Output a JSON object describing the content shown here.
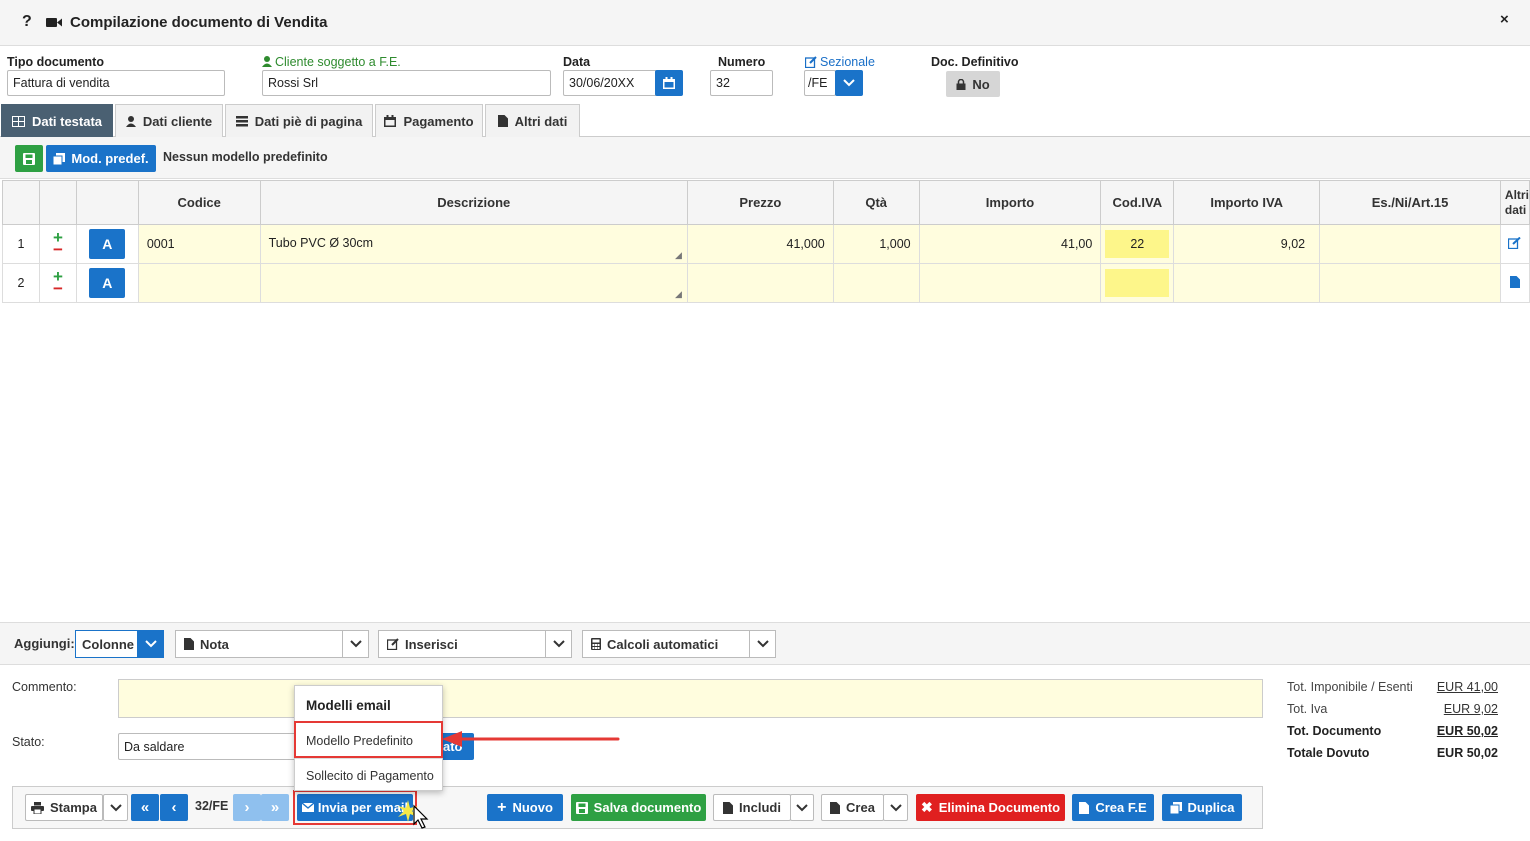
{
  "window": {
    "help": "?",
    "title": "Compilazione documento di Vendita",
    "close": "×"
  },
  "header": {
    "tipo_label": "Tipo documento",
    "tipo_value": "Fattura di vendita",
    "cliente_label": "Cliente soggetto a F.E.",
    "cliente_value": "Rossi Srl",
    "data_label": "Data",
    "data_value": "30/06/20XX",
    "numero_label": "Numero",
    "numero_value": "32",
    "sezionale_label": "Sezionale",
    "sezionale_value": "/FE",
    "def_label": "Doc. Definitivo",
    "def_value": "No"
  },
  "tabs": [
    "Dati testata",
    "Dati cliente",
    "Dati piè di pagina",
    "Pagamento",
    "Altri dati"
  ],
  "toolbar": {
    "mod_label": "Mod. predef.",
    "mod_status": "Nessun modello predefinito"
  },
  "grid": {
    "columns": [
      "Codice",
      "Descrizione",
      "Prezzo",
      "Qtà",
      "Importo",
      "Cod.IVA",
      "Importo IVA",
      "Es./Ni/Art.15",
      "Altri dati"
    ],
    "rows": [
      {
        "n": "1",
        "a": "A",
        "codice": "0001",
        "descrizione": "Tubo PVC Ø 30cm",
        "prezzo": "41,000",
        "qta": "1,000",
        "importo": "41,00",
        "iva": "22",
        "importo_iva": "9,02",
        "es": ""
      },
      {
        "n": "2",
        "a": "A",
        "codice": "",
        "descrizione": "",
        "prezzo": "",
        "qta": "",
        "importo": "",
        "iva": "",
        "importo_iva": "",
        "es": ""
      }
    ]
  },
  "add_bar": {
    "label": "Aggiungi:",
    "colonne": "Colonne",
    "nota": "Nota",
    "inserisci": "Inserisci",
    "calcoli": "Calcoli automatici"
  },
  "footer": {
    "commento_label": "Commento:",
    "commento_value": "",
    "stato_label": "Stato:",
    "stato_value": "Da saldare",
    "stato_btn": "ato"
  },
  "totals": [
    {
      "label": "Tot. Imponibile / Esenti",
      "value": "EUR 41,00"
    },
    {
      "label": "Tot. Iva",
      "value": "EUR 9,02"
    },
    {
      "label": "Tot. Documento",
      "value": "EUR 50,02"
    },
    {
      "label": "Totale Dovuto",
      "value": "EUR 50,02"
    }
  ],
  "email_menu": {
    "header": "Modelli email",
    "items": [
      "Modello Predefinito",
      "Sollecito di Pagamento"
    ]
  },
  "bottom_bar": {
    "stampa": "Stampa",
    "nav_first": "«",
    "nav_prev": "‹",
    "doc_id": "32/FE",
    "nav_next": "›",
    "nav_last": "»",
    "email": "Invia per email",
    "nuovo": "Nuovo",
    "salva": "Salva documento",
    "includi": "Includi",
    "crea": "Crea",
    "elimina": "Elimina Documento",
    "crea_fe": "Crea F.E",
    "duplica": "Duplica"
  },
  "colors": {
    "primary": "#1a73c9",
    "success": "#2ea043",
    "danger": "#e02020",
    "highlight": "#e53935",
    "tab_active": "#4a6072",
    "row_bg": "#fffdde"
  }
}
